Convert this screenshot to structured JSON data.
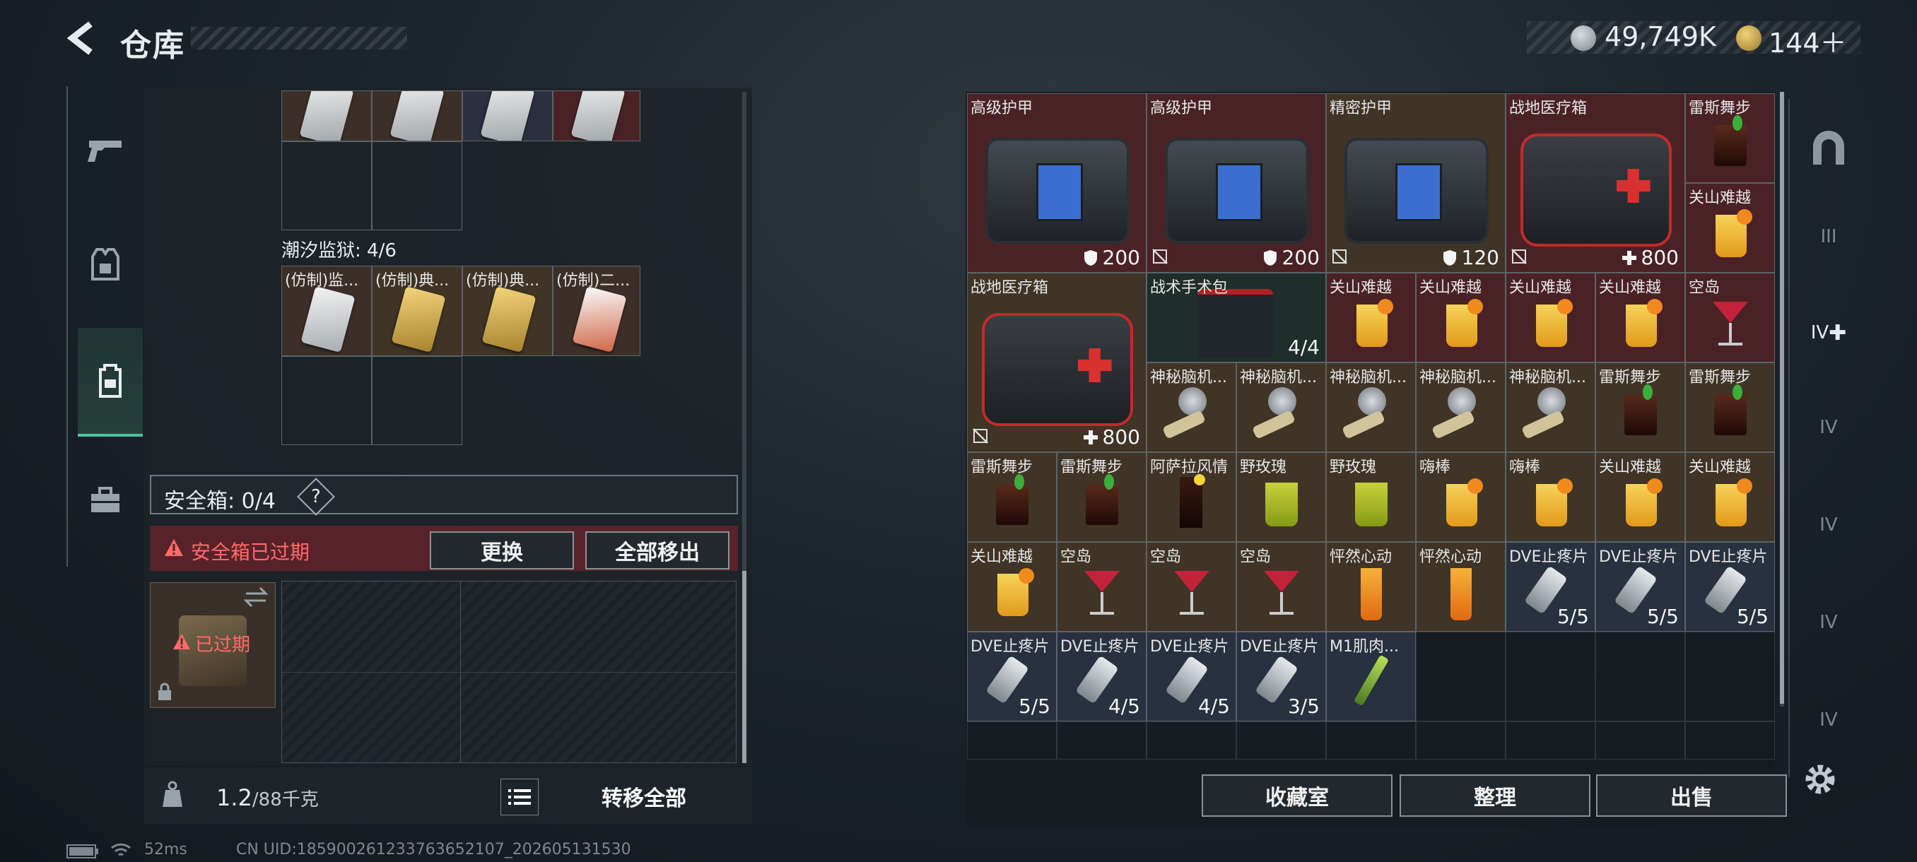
{
  "header": {
    "title": "仓库"
  },
  "currency": {
    "silver": "49,749K",
    "gold": "144＋"
  },
  "left": {
    "prison_label": "潮汐监狱: 4/6",
    "prison_items": [
      "(仿制)监...",
      "(仿制)典...",
      "(仿制)典...",
      "(仿制)二..."
    ],
    "safe_box": {
      "label": "安全箱: 0/4",
      "help": "?",
      "expired_warning": "安全箱已过期",
      "expired_badge": "已过期"
    },
    "buttons": {
      "replace": "更换",
      "move_all": "全部移出",
      "transfer_all": "转移全部"
    },
    "weight": {
      "current": "1.2",
      "max": "/88千克"
    }
  },
  "status": {
    "ping": "52ms",
    "uid": "CN UID:18590026123376365210​7_202605131530"
  },
  "right": {
    "items": [
      {
        "name": "高级护甲",
        "stat": "200",
        "stat_icon": "shield"
      },
      {
        "name": "高级护甲",
        "stat": "200",
        "stat_icon": "shield"
      },
      {
        "name": "精密护甲",
        "stat": "120",
        "stat_icon": "shield"
      },
      {
        "name": "战地医疗箱",
        "stat": "800",
        "stat_icon": "plus"
      },
      {
        "name": "雷斯舞步"
      },
      {
        "name": "关山难越"
      },
      {
        "name": "战地医疗箱",
        "stat": "800",
        "stat_icon": "plus"
      },
      {
        "name": "战术手术包",
        "stat": "4/4"
      },
      {
        "name": "关山难越"
      },
      {
        "name": "关山难越"
      },
      {
        "name": "关山难越"
      },
      {
        "name": "关山难越"
      },
      {
        "name": "空岛"
      },
      {
        "name": "神秘脑机..."
      },
      {
        "name": "神秘脑机..."
      },
      {
        "name": "神秘脑机..."
      },
      {
        "name": "神秘脑机..."
      },
      {
        "name": "神秘脑机..."
      },
      {
        "name": "雷斯舞步"
      },
      {
        "name": "雷斯舞步"
      },
      {
        "name": "雷斯舞步"
      },
      {
        "name": "雷斯舞步"
      },
      {
        "name": "阿萨拉风情"
      },
      {
        "name": "野玫瑰"
      },
      {
        "name": "野玫瑰"
      },
      {
        "name": "嗨棒"
      },
      {
        "name": "嗨棒"
      },
      {
        "name": "关山难越"
      },
      {
        "name": "关山难越"
      },
      {
        "name": "关山难越"
      },
      {
        "name": "空岛"
      },
      {
        "name": "空岛"
      },
      {
        "name": "空岛"
      },
      {
        "name": "怦然心动"
      },
      {
        "name": "怦然心动"
      },
      {
        "name": "DVE止疼片",
        "stat": "5/5"
      },
      {
        "name": "DVE止疼片",
        "stat": "5/5"
      },
      {
        "name": "DVE止疼片",
        "stat": "5/5"
      },
      {
        "name": "DVE止疼片",
        "stat": "5/5"
      },
      {
        "name": "DVE止疼片",
        "stat": "4/5"
      },
      {
        "name": "DVE止疼片",
        "stat": "4/5"
      },
      {
        "name": "DVE止疼片",
        "stat": "3/5"
      },
      {
        "name": "M1肌肉..."
      }
    ],
    "buttons": {
      "collection": "收藏室",
      "sort": "整理",
      "sell": "出售"
    },
    "side_nav": [
      "III",
      "IV",
      "IV",
      "IV",
      "IV",
      "IV"
    ]
  },
  "colors": {
    "accent": "#47c9a3",
    "warning": "#ff6a6a",
    "rare_red": "#4a2226",
    "rare_gold": "#3f3426",
    "rare_blue": "#27313f"
  }
}
